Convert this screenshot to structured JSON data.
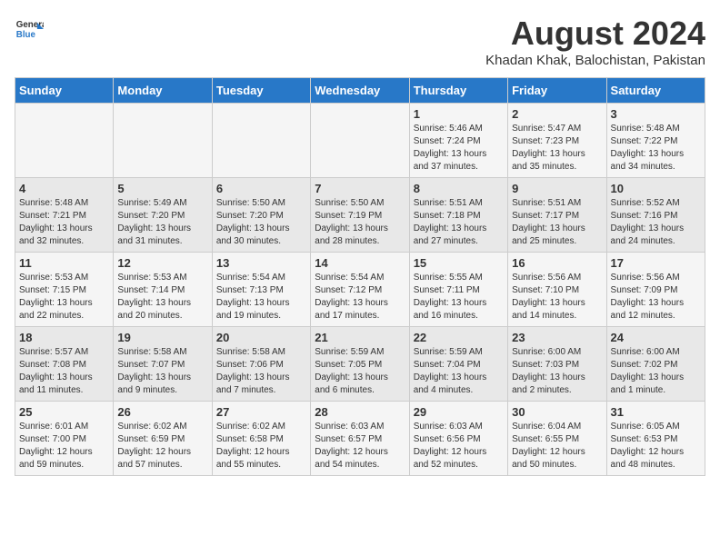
{
  "header": {
    "logo_line1": "General",
    "logo_line2": "Blue",
    "month_year": "August 2024",
    "location": "Khadan Khak, Balochistan, Pakistan"
  },
  "weekdays": [
    "Sunday",
    "Monday",
    "Tuesday",
    "Wednesday",
    "Thursday",
    "Friday",
    "Saturday"
  ],
  "weeks": [
    [
      {
        "day": "",
        "info": ""
      },
      {
        "day": "",
        "info": ""
      },
      {
        "day": "",
        "info": ""
      },
      {
        "day": "",
        "info": ""
      },
      {
        "day": "1",
        "info": "Sunrise: 5:46 AM\nSunset: 7:24 PM\nDaylight: 13 hours\nand 37 minutes."
      },
      {
        "day": "2",
        "info": "Sunrise: 5:47 AM\nSunset: 7:23 PM\nDaylight: 13 hours\nand 35 minutes."
      },
      {
        "day": "3",
        "info": "Sunrise: 5:48 AM\nSunset: 7:22 PM\nDaylight: 13 hours\nand 34 minutes."
      }
    ],
    [
      {
        "day": "4",
        "info": "Sunrise: 5:48 AM\nSunset: 7:21 PM\nDaylight: 13 hours\nand 32 minutes."
      },
      {
        "day": "5",
        "info": "Sunrise: 5:49 AM\nSunset: 7:20 PM\nDaylight: 13 hours\nand 31 minutes."
      },
      {
        "day": "6",
        "info": "Sunrise: 5:50 AM\nSunset: 7:20 PM\nDaylight: 13 hours\nand 30 minutes."
      },
      {
        "day": "7",
        "info": "Sunrise: 5:50 AM\nSunset: 7:19 PM\nDaylight: 13 hours\nand 28 minutes."
      },
      {
        "day": "8",
        "info": "Sunrise: 5:51 AM\nSunset: 7:18 PM\nDaylight: 13 hours\nand 27 minutes."
      },
      {
        "day": "9",
        "info": "Sunrise: 5:51 AM\nSunset: 7:17 PM\nDaylight: 13 hours\nand 25 minutes."
      },
      {
        "day": "10",
        "info": "Sunrise: 5:52 AM\nSunset: 7:16 PM\nDaylight: 13 hours\nand 24 minutes."
      }
    ],
    [
      {
        "day": "11",
        "info": "Sunrise: 5:53 AM\nSunset: 7:15 PM\nDaylight: 13 hours\nand 22 minutes."
      },
      {
        "day": "12",
        "info": "Sunrise: 5:53 AM\nSunset: 7:14 PM\nDaylight: 13 hours\nand 20 minutes."
      },
      {
        "day": "13",
        "info": "Sunrise: 5:54 AM\nSunset: 7:13 PM\nDaylight: 13 hours\nand 19 minutes."
      },
      {
        "day": "14",
        "info": "Sunrise: 5:54 AM\nSunset: 7:12 PM\nDaylight: 13 hours\nand 17 minutes."
      },
      {
        "day": "15",
        "info": "Sunrise: 5:55 AM\nSunset: 7:11 PM\nDaylight: 13 hours\nand 16 minutes."
      },
      {
        "day": "16",
        "info": "Sunrise: 5:56 AM\nSunset: 7:10 PM\nDaylight: 13 hours\nand 14 minutes."
      },
      {
        "day": "17",
        "info": "Sunrise: 5:56 AM\nSunset: 7:09 PM\nDaylight: 13 hours\nand 12 minutes."
      }
    ],
    [
      {
        "day": "18",
        "info": "Sunrise: 5:57 AM\nSunset: 7:08 PM\nDaylight: 13 hours\nand 11 minutes."
      },
      {
        "day": "19",
        "info": "Sunrise: 5:58 AM\nSunset: 7:07 PM\nDaylight: 13 hours\nand 9 minutes."
      },
      {
        "day": "20",
        "info": "Sunrise: 5:58 AM\nSunset: 7:06 PM\nDaylight: 13 hours\nand 7 minutes."
      },
      {
        "day": "21",
        "info": "Sunrise: 5:59 AM\nSunset: 7:05 PM\nDaylight: 13 hours\nand 6 minutes."
      },
      {
        "day": "22",
        "info": "Sunrise: 5:59 AM\nSunset: 7:04 PM\nDaylight: 13 hours\nand 4 minutes."
      },
      {
        "day": "23",
        "info": "Sunrise: 6:00 AM\nSunset: 7:03 PM\nDaylight: 13 hours\nand 2 minutes."
      },
      {
        "day": "24",
        "info": "Sunrise: 6:00 AM\nSunset: 7:02 PM\nDaylight: 13 hours\nand 1 minute."
      }
    ],
    [
      {
        "day": "25",
        "info": "Sunrise: 6:01 AM\nSunset: 7:00 PM\nDaylight: 12 hours\nand 59 minutes."
      },
      {
        "day": "26",
        "info": "Sunrise: 6:02 AM\nSunset: 6:59 PM\nDaylight: 12 hours\nand 57 minutes."
      },
      {
        "day": "27",
        "info": "Sunrise: 6:02 AM\nSunset: 6:58 PM\nDaylight: 12 hours\nand 55 minutes."
      },
      {
        "day": "28",
        "info": "Sunrise: 6:03 AM\nSunset: 6:57 PM\nDaylight: 12 hours\nand 54 minutes."
      },
      {
        "day": "29",
        "info": "Sunrise: 6:03 AM\nSunset: 6:56 PM\nDaylight: 12 hours\nand 52 minutes."
      },
      {
        "day": "30",
        "info": "Sunrise: 6:04 AM\nSunset: 6:55 PM\nDaylight: 12 hours\nand 50 minutes."
      },
      {
        "day": "31",
        "info": "Sunrise: 6:05 AM\nSunset: 6:53 PM\nDaylight: 12 hours\nand 48 minutes."
      }
    ]
  ]
}
